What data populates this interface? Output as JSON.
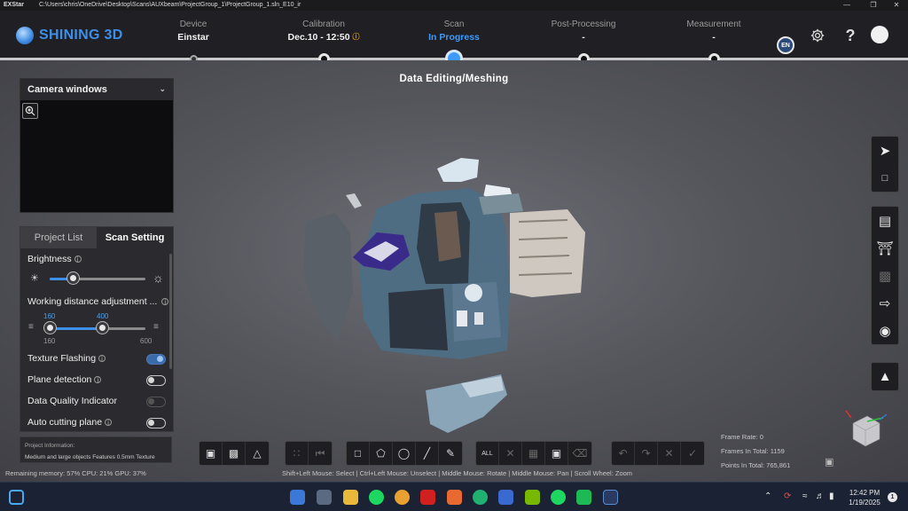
{
  "window": {
    "app_name": "EXStar",
    "path": "C:\\Users\\chris\\OneDrive\\Desktop\\Scans\\AUXbeam\\ProjectGroup_1\\ProjectGroup_1.sln_E10_ir"
  },
  "brand": {
    "name": "SHINING 3D",
    "color": "#3d8fe8"
  },
  "steps": [
    {
      "label": "Device",
      "value": "Einstar"
    },
    {
      "label": "Calibration",
      "value": "Dec.10 - 12:50"
    },
    {
      "label": "Scan",
      "value": "In Progress"
    },
    {
      "label": "Post-Processing",
      "value": "-"
    },
    {
      "label": "Measurement",
      "value": "-"
    }
  ],
  "substep": "Data Editing/Meshing",
  "header_icons": [
    "region-badge",
    "gear-icon",
    "help-icon",
    "user-avatar"
  ],
  "region_badge": "EN",
  "camera_panel": {
    "title": "Camera windows"
  },
  "settings_panel": {
    "tabs": [
      {
        "label": "Project List"
      },
      {
        "label": "Scan Setting"
      }
    ],
    "active_tab": "Scan Setting",
    "brightness": {
      "label": "Brightness",
      "level_fraction": 0.25
    },
    "working_distance": {
      "label": "Working distance adjustment ...",
      "low": "160",
      "high": "400",
      "min": "160",
      "max": "600"
    },
    "toggles": [
      {
        "label": "Texture Flashing",
        "on": true,
        "disabled": false
      },
      {
        "label": "Plane detection",
        "on": false,
        "disabled": false
      },
      {
        "label": "Data Quality Indicator",
        "on": false,
        "disabled": true
      },
      {
        "label": "Auto cutting plane",
        "on": false,
        "disabled": false
      }
    ]
  },
  "project_info": {
    "title": "Project Information:",
    "details": "Medium and large objects  Features  0.5mm  Texture"
  },
  "stats": {
    "frame_rate": "Frame Rate: 0",
    "frames_total": "Frames In Total: 1159",
    "points_total": "Points In Total: 765,861"
  },
  "status": {
    "memory": "Remaining memory: 57% CPU: 21% GPU: 37%",
    "hints": "Shift+Left Mouse: Select | Ctrl+Left Mouse: Unselect | Middle Mouse: Rotate | Middle Mouse: Pan | Scroll Wheel: Zoom"
  },
  "taskbar": {
    "time": "12:42 PM",
    "date": "1/19/2025",
    "badge": "1"
  },
  "colors": {
    "accent": "#3d9bff",
    "header_bg": "#202024",
    "warning": "#e0a020"
  }
}
